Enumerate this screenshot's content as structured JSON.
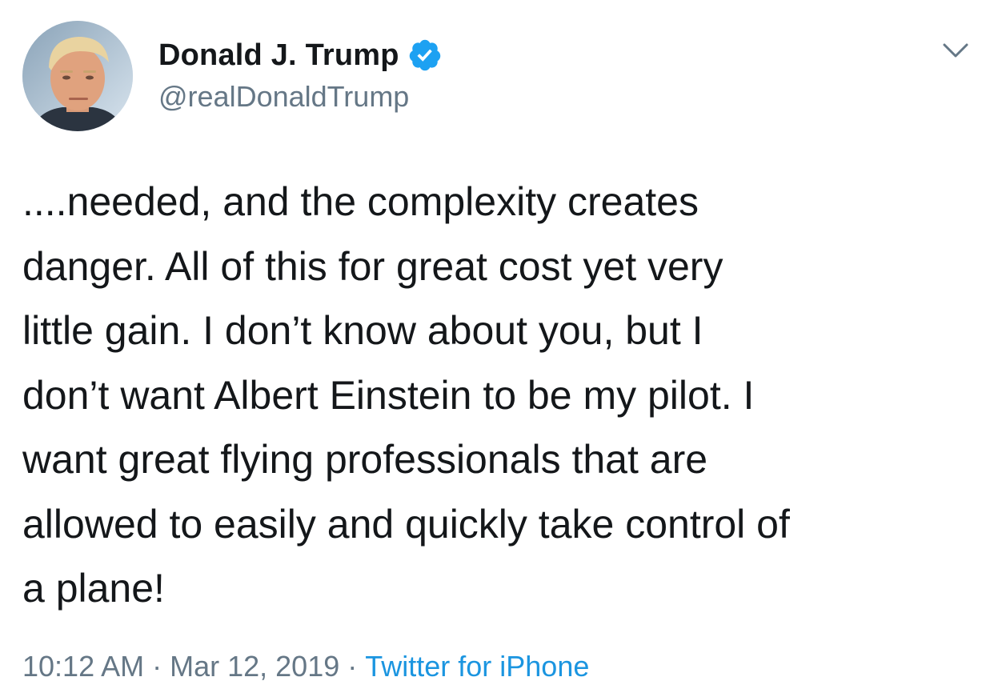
{
  "author": {
    "display_name": "Donald J. Trump",
    "handle": "@realDonaldTrump",
    "verified": true,
    "verified_icon": "verified-badge-icon"
  },
  "tweet": {
    "text": "....needed, and the complexity creates\ndanger. All of this for great cost yet very\nlittle gain. I don’t know about you, but I\ndon’t want Albert Einstein to be my pilot. I\nwant great flying professionals that are\nallowed to easily and quickly take control of\na plane!"
  },
  "meta": {
    "time": "10:12 AM",
    "separator": "·",
    "date": "Mar 12, 2019",
    "source": "Twitter for iPhone"
  },
  "icons": {
    "menu": "chevron-down-icon"
  },
  "colors": {
    "text": "#14171a",
    "secondary": "#657786",
    "link": "#1b95e0",
    "verified": "#1da1f2"
  }
}
